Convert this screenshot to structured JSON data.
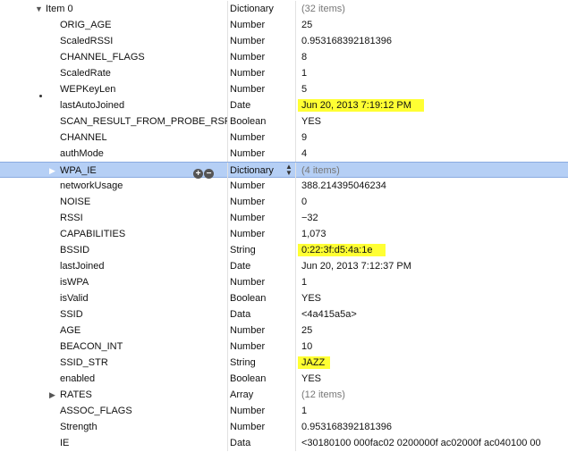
{
  "rows": [
    {
      "key": "Item 0",
      "type": "Dictionary",
      "value": "(32 items)",
      "indent": 51,
      "tri": "down",
      "muted": true
    },
    {
      "key": "ORIG_AGE",
      "type": "Number",
      "value": "25",
      "indent": 67
    },
    {
      "key": "ScaledRSSI",
      "type": "Number",
      "value": "0.953168392181396",
      "indent": 67
    },
    {
      "key": "CHANNEL_FLAGS",
      "type": "Number",
      "value": "8",
      "indent": 67
    },
    {
      "key": "ScaledRate",
      "type": "Number",
      "value": "1",
      "indent": 67
    },
    {
      "key": "WEPKeyLen",
      "type": "Number",
      "value": "5",
      "indent": 67
    },
    {
      "key": "lastAutoJoined",
      "type": "Date",
      "value": "Jun 20, 2013 7:19:12 PM",
      "indent": 67,
      "highlight": true
    },
    {
      "key": "SCAN_RESULT_FROM_PROBE_RSP",
      "type": "Boolean",
      "value": "YES",
      "indent": 67
    },
    {
      "key": "CHANNEL",
      "type": "Number",
      "value": "9",
      "indent": 67
    },
    {
      "key": "authMode",
      "type": "Number",
      "value": "4",
      "indent": 67
    },
    {
      "key": "WPA_IE",
      "type": "Dictionary",
      "value": "(4 items)",
      "indent": 67,
      "tri": "right",
      "selected": true,
      "muted": true
    },
    {
      "key": "networkUsage",
      "type": "Number",
      "value": "388.214395046234",
      "indent": 67
    },
    {
      "key": "NOISE",
      "type": "Number",
      "value": "0",
      "indent": 67
    },
    {
      "key": "RSSI",
      "type": "Number",
      "value": "−32",
      "indent": 67
    },
    {
      "key": "CAPABILITIES",
      "type": "Number",
      "value": "1,073",
      "indent": 67
    },
    {
      "key": "BSSID",
      "type": "String",
      "value": "0:22:3f:d5:4a:1e",
      "indent": 67,
      "highlight": true
    },
    {
      "key": "lastJoined",
      "type": "Date",
      "value": "Jun 20, 2013 7:12:37 PM",
      "indent": 67
    },
    {
      "key": "isWPA",
      "type": "Number",
      "value": "1",
      "indent": 67
    },
    {
      "key": "isValid",
      "type": "Boolean",
      "value": "YES",
      "indent": 67
    },
    {
      "key": "SSID",
      "type": "Data",
      "value": "<4a415a5a>",
      "indent": 67
    },
    {
      "key": "AGE",
      "type": "Number",
      "value": "25",
      "indent": 67
    },
    {
      "key": "BEACON_INT",
      "type": "Number",
      "value": "10",
      "indent": 67
    },
    {
      "key": "SSID_STR",
      "type": "String",
      "value": "JAZZ",
      "indent": 67,
      "highlight": true
    },
    {
      "key": "enabled",
      "type": "Boolean",
      "value": "YES",
      "indent": 67
    },
    {
      "key": "RATES",
      "type": "Array",
      "value": "(12 items)",
      "indent": 67,
      "tri": "right",
      "muted": true
    },
    {
      "key": "ASSOC_FLAGS",
      "type": "Number",
      "value": "1",
      "indent": 67
    },
    {
      "key": "Strength",
      "type": "Number",
      "value": "0.953168392181396",
      "indent": 67
    },
    {
      "key": "IE",
      "type": "Data",
      "value": "<30180100 000fac02 0200000f ac02000f ac040100 00",
      "indent": 67
    }
  ],
  "selected_row": {
    "add_icon": "plus-circle-icon",
    "remove_icon": "minus-circle-icon",
    "stepper_icon": "up-down-stepper-icon"
  },
  "colors": {
    "highlight": "#ffff33",
    "selection": "#b5cff5"
  }
}
